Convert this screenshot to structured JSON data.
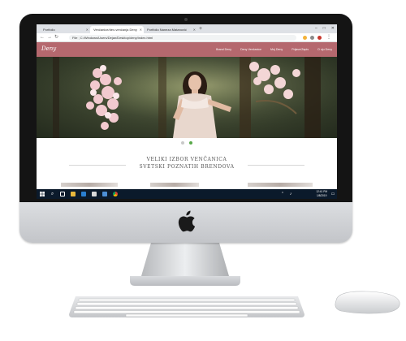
{
  "browser": {
    "tabs": [
      {
        "label": "Portfolio"
      },
      {
        "label": "Venčanice/dex-venčanja Deny"
      },
      {
        "label": "Portfolio Naneza Matanović"
      }
    ],
    "new_tab_symbol": "+",
    "url": "C:/Windows/Users/Dejan/Desktop/deny/index.html",
    "url_prefix": "File",
    "window_controls": [
      "–",
      "□",
      "✕"
    ]
  },
  "site": {
    "logo": "Deny",
    "menu": [
      "Brand Deny",
      "Deny Venčanice",
      "Moj Deny",
      "Prijave/Zapis",
      "O nju Deny"
    ],
    "carousel_dots": 2,
    "carousel_active_index": 1,
    "headline_line1": "Veliki izbor venčanica",
    "headline_line2": "Svetski poznatih brendova",
    "colors": {
      "nav": "#b5686e",
      "dot_active": "#59a94a"
    }
  },
  "taskbar": {
    "time": "12:41 PM",
    "date": "1/8/2019",
    "icons": [
      "windows-start-icon",
      "search-icon",
      "task-view-icon",
      "file-explorer-icon",
      "store-icon",
      "mail-icon",
      "photos-icon",
      "chrome-icon"
    ]
  }
}
